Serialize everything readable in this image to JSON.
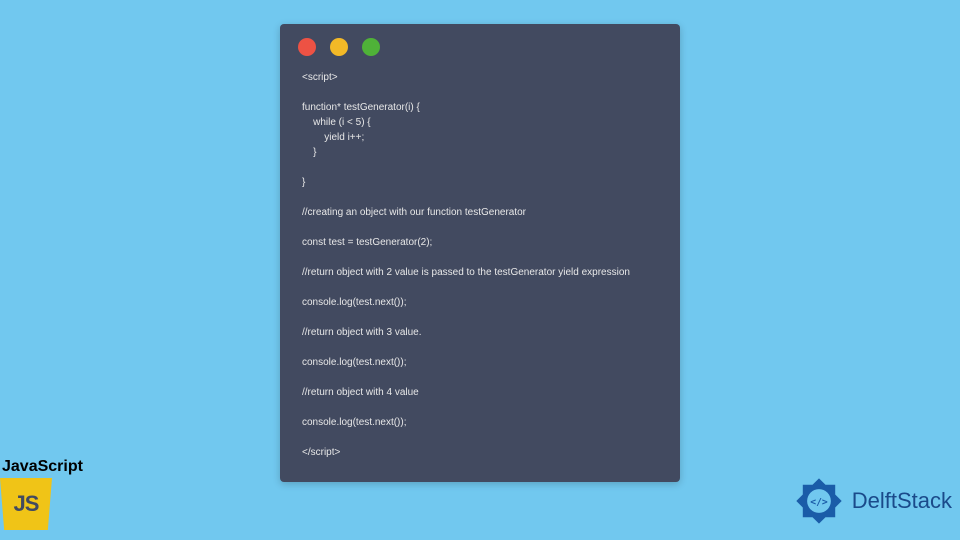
{
  "code_window": {
    "lines": "<script>\n\nfunction* testGenerator(i) {\n    while (i < 5) {\n        yield i++;\n    }\n\n}\n\n//creating an object with our function testGenerator\n\nconst test = testGenerator(2);\n\n//return object with 2 value is passed to the testGenerator yield expression\n\nconsole.log(test.next());\n\n//return object with 3 value.\n\nconsole.log(test.next());\n\n//return object with 4 value\n\nconsole.log(test.next());\n\n</script>"
  },
  "js_badge": {
    "label": "JavaScript",
    "logo_text": "JS"
  },
  "brand": {
    "name": "DelftStack"
  },
  "colors": {
    "page_bg": "#71c8ef",
    "window_bg": "#424a60",
    "traffic_red": "#ed5244",
    "traffic_yellow": "#f3b927",
    "traffic_green": "#4fb238",
    "js_yellow": "#f0c417",
    "brand_blue": "#1a4a8a"
  }
}
